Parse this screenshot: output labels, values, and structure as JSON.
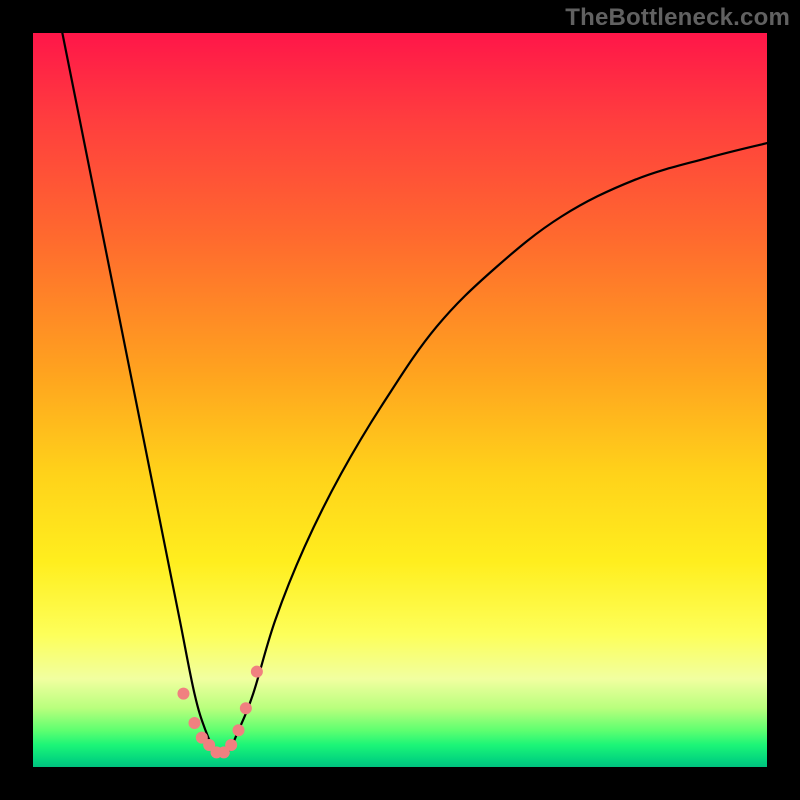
{
  "watermark": "TheBottleneck.com",
  "chart_data": {
    "type": "line",
    "title": "",
    "xlabel": "",
    "ylabel": "",
    "xlim": [
      0,
      100
    ],
    "ylim": [
      0,
      100
    ],
    "gradient_stops": [
      {
        "pct": 0,
        "color": "#ff1649"
      },
      {
        "pct": 12,
        "color": "#ff3e3e"
      },
      {
        "pct": 28,
        "color": "#ff6a2e"
      },
      {
        "pct": 46,
        "color": "#ffa21f"
      },
      {
        "pct": 60,
        "color": "#ffd21a"
      },
      {
        "pct": 72,
        "color": "#ffee1e"
      },
      {
        "pct": 82,
        "color": "#fdff5a"
      },
      {
        "pct": 88,
        "color": "#f1ffa0"
      },
      {
        "pct": 92,
        "color": "#b8ff7d"
      },
      {
        "pct": 95,
        "color": "#5fff70"
      },
      {
        "pct": 97,
        "color": "#1cf577"
      },
      {
        "pct": 99,
        "color": "#04d67e"
      },
      {
        "pct": 100,
        "color": "#00c27e"
      }
    ],
    "series": [
      {
        "name": "bottleneck-curve",
        "x": [
          4,
          6,
          8,
          10,
          12,
          14,
          16,
          18,
          20,
          22,
          23.5,
          25,
          26.5,
          28,
          30,
          33,
          37,
          42,
          48,
          55,
          63,
          72,
          82,
          92,
          100
        ],
        "y": [
          100,
          90,
          80,
          70,
          60,
          50,
          40,
          30,
          20,
          10,
          5,
          2,
          2,
          5,
          10,
          20,
          30,
          40,
          50,
          60,
          68,
          75,
          80,
          83,
          85
        ]
      }
    ],
    "markers": {
      "name": "trough-markers",
      "color": "#f08080",
      "radius": 6,
      "points": [
        {
          "x": 20.5,
          "y": 10
        },
        {
          "x": 22.0,
          "y": 6
        },
        {
          "x": 23.0,
          "y": 4
        },
        {
          "x": 24.0,
          "y": 3
        },
        {
          "x": 25.0,
          "y": 2
        },
        {
          "x": 26.0,
          "y": 2
        },
        {
          "x": 27.0,
          "y": 3
        },
        {
          "x": 28.0,
          "y": 5
        },
        {
          "x": 29.0,
          "y": 8
        },
        {
          "x": 30.5,
          "y": 13
        }
      ]
    }
  }
}
